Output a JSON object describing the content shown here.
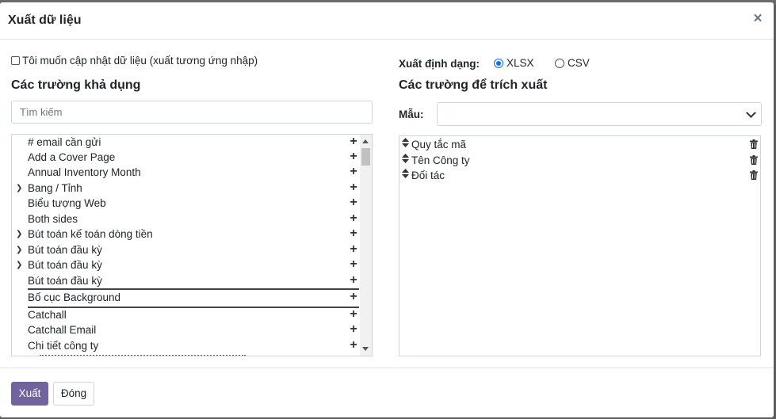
{
  "dialog": {
    "title": "Xuất dữ liệu",
    "close_label": "×",
    "import_compat_label": "Tôi muốn cập nhật dữ liệu (xuất tương ứng nhập)",
    "available_title": "Các trường khả dụng",
    "search_placeholder": "Tìm kiếm",
    "export_format_label": "Xuất định dạng:",
    "formats": [
      {
        "label": "XLSX",
        "selected": true
      },
      {
        "label": "CSV",
        "selected": false
      }
    ],
    "export_fields_title": "Các trường để trích xuất",
    "template_label": "Mẫu:",
    "template_value": ""
  },
  "available_fields": [
    {
      "label": "# email cần gửi",
      "expandable": false
    },
    {
      "label": "Add a Cover Page",
      "expandable": false
    },
    {
      "label": "Annual Inventory Month",
      "expandable": false
    },
    {
      "label": "Bang / Tỉnh",
      "expandable": true
    },
    {
      "label": "Biểu tượng Web",
      "expandable": false
    },
    {
      "label": "Both sides",
      "expandable": false
    },
    {
      "label": "Bút toán kế toán dòng tiền",
      "expandable": true
    },
    {
      "label": "Bút toán đầu kỳ",
      "expandable": true
    },
    {
      "label": "Bút toán đầu kỳ",
      "expandable": true
    },
    {
      "label": "Bút toán đầu kỳ",
      "expandable": false
    },
    {
      "label": "Bố cục Background",
      "expandable": false,
      "selected": true
    },
    {
      "label": "Catchall",
      "expandable": false
    },
    {
      "label": "Catchall Email",
      "expandable": false
    },
    {
      "label": "Chi tiết công ty",
      "expandable": false
    }
  ],
  "export_fields": [
    {
      "label": "Quy tắc mã"
    },
    {
      "label": "Tên Công ty"
    },
    {
      "label": "Đối tác"
    }
  ],
  "footer": {
    "export_label": "Xuất",
    "close_label": "Đóng"
  },
  "colors": {
    "primary": "#71639e",
    "radio_accent": "#0d6efd"
  }
}
